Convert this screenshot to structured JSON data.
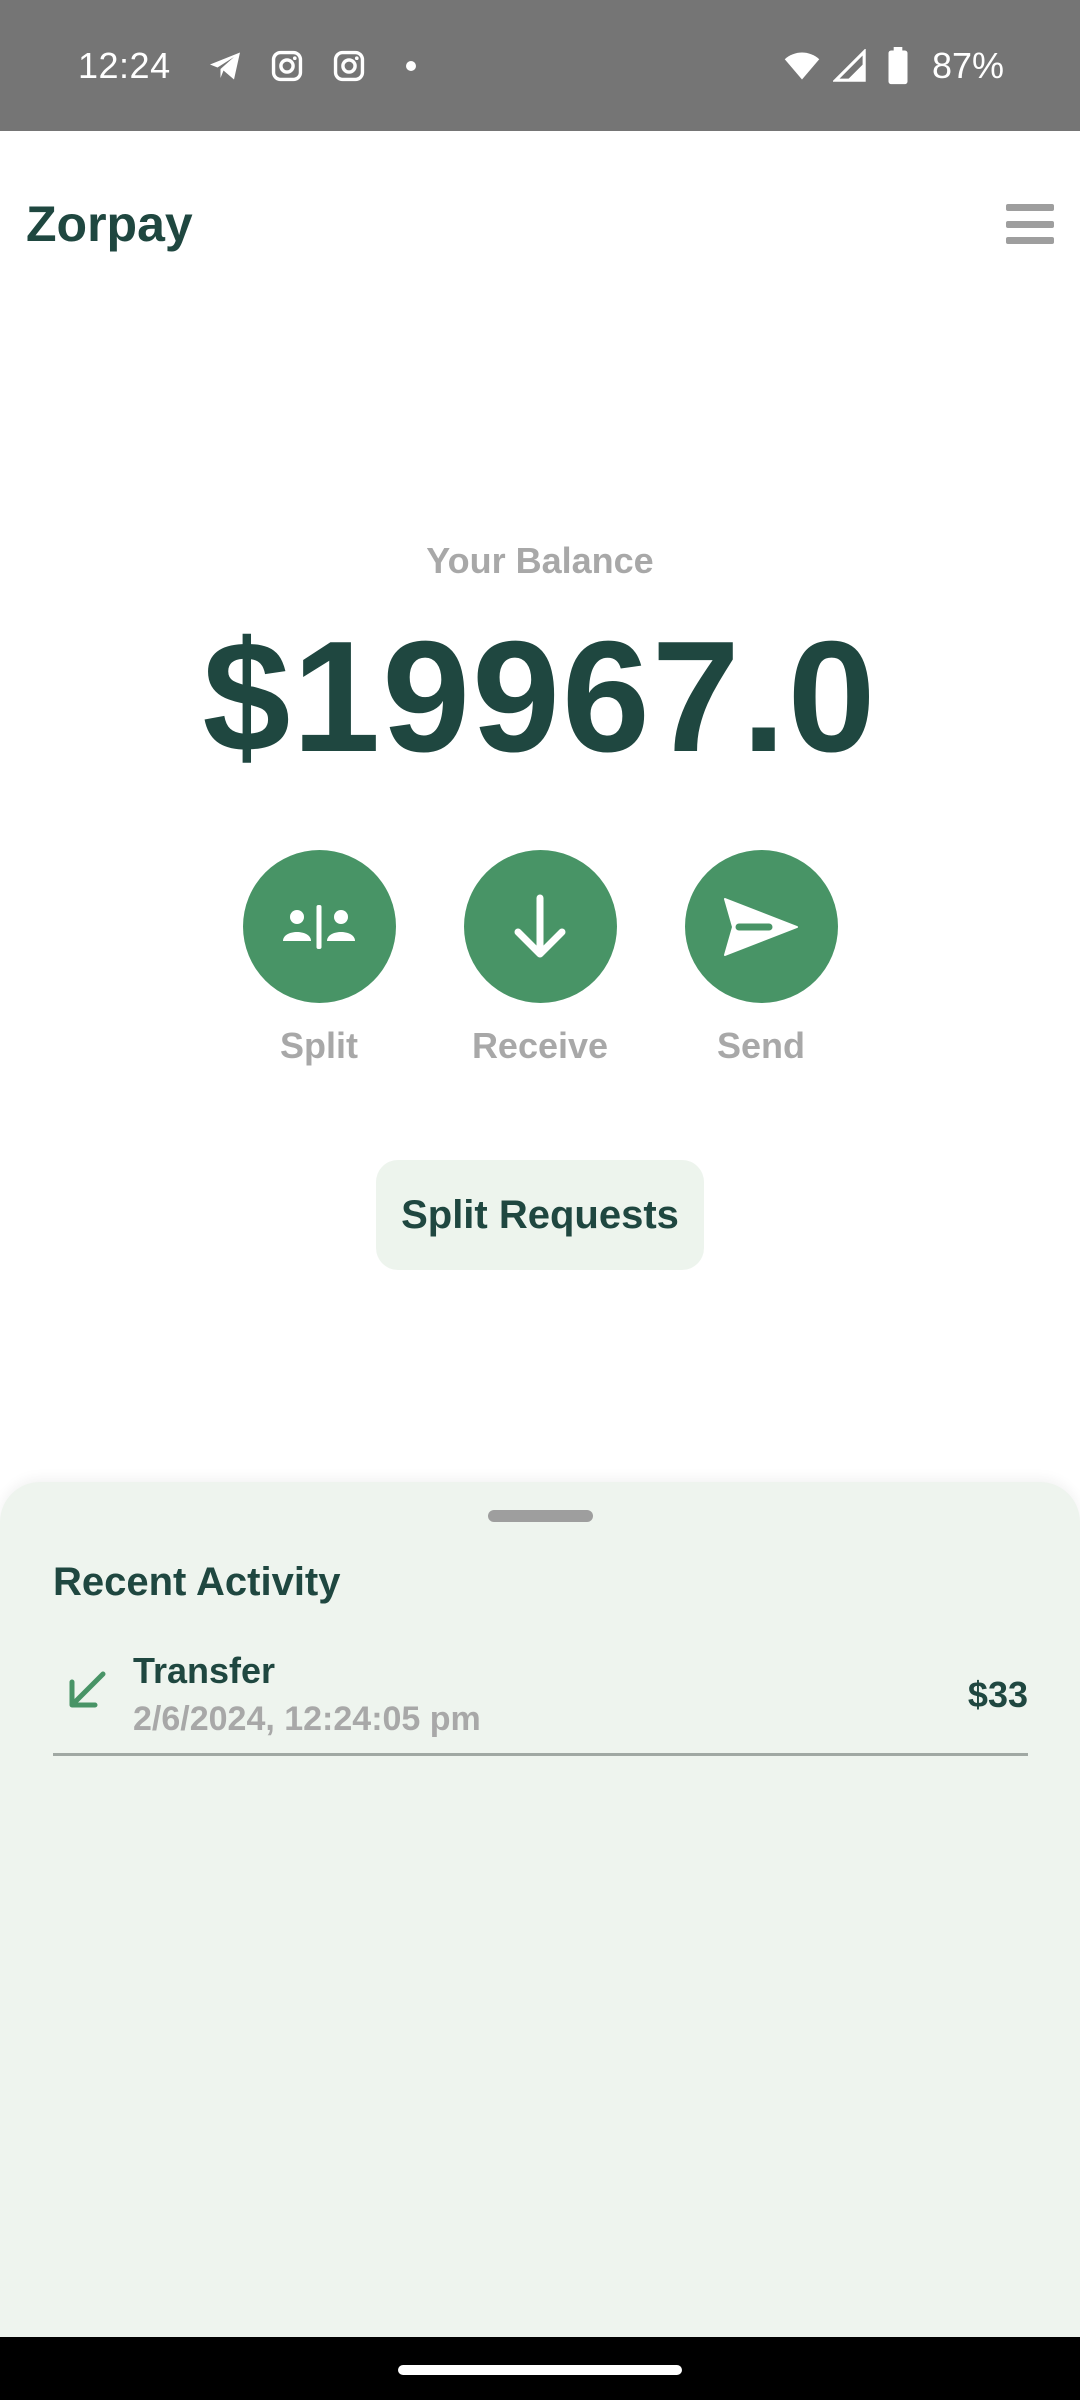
{
  "status_bar": {
    "time": "12:24",
    "battery": "87%",
    "notification_icons": [
      "telegram-icon",
      "instagram-icon",
      "instagram-icon",
      "dot-icon"
    ],
    "system_icons": [
      "wifi-icon",
      "signal-icon",
      "battery-icon"
    ]
  },
  "header": {
    "title": "Zorpay",
    "menu_icon": "hamburger-menu-icon"
  },
  "balance": {
    "label": "Your Balance",
    "amount": "$19967.0"
  },
  "actions": [
    {
      "label": "Split",
      "icon": "split-people-icon"
    },
    {
      "label": "Receive",
      "icon": "arrow-down-icon"
    },
    {
      "label": "Send",
      "icon": "send-icon"
    }
  ],
  "split_requests": {
    "label": "Split Requests"
  },
  "recent_activity": {
    "title": "Recent Activity",
    "transactions": [
      {
        "title": "Transfer",
        "date": "2/6/2024, 12:24:05 pm",
        "amount": "$33",
        "icon": "arrow-down-left-icon"
      }
    ]
  },
  "colors": {
    "primary": "#1f4740",
    "accent": "#489466",
    "muted": "#a8a8a8",
    "sheet_bg": "#eef4ee"
  }
}
